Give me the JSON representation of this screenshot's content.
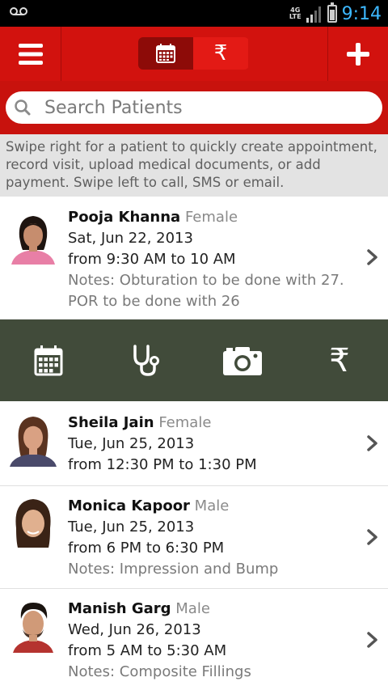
{
  "status_bar": {
    "time": "9:14",
    "network_line1": "4G",
    "network_line2": "LTE",
    "voicemail_icon": "voicemail-icon",
    "accent": "#3db8ff"
  },
  "action_bar": {
    "menu_icon": "menu-icon",
    "calendar_icon": "calendar-icon",
    "rupee_label": "₹",
    "add_icon": "plus-icon",
    "color": "#d2120e"
  },
  "search": {
    "placeholder": "Search Patients"
  },
  "hint": {
    "text": "Swipe right for a patient to quickly create appointment, record visit, upload medical documents, or add payment. Swipe left to call, SMS or email."
  },
  "patients": [
    {
      "name": "Pooja Khanna",
      "gender": "Female",
      "date": "Sat, Jun 22, 2013",
      "time": "from 9:30 AM to 10 AM",
      "notes": "Notes: Obturation to be done with 27. POR to be done with 26"
    },
    {
      "name": "Sheila Jain",
      "gender": "Female",
      "date": "Tue, Jun 25, 2013",
      "time": "from 12:30 PM to 1:30 PM",
      "notes": ""
    },
    {
      "name": "Monica Kapoor",
      "gender": "Male",
      "date": "Tue, Jun 25, 2013",
      "time": "from 6 PM to 6:30 PM",
      "notes": "Notes: Impression and Bump"
    },
    {
      "name": "Manish Garg",
      "gender": "Male",
      "date": "Wed, Jun 26, 2013",
      "time": "from 5 AM to 5:30 AM",
      "notes": "Notes: Composite Fillings"
    }
  ],
  "swipe_actions": {
    "icons": [
      "calendar-icon",
      "stethoscope-icon",
      "camera-icon",
      "rupee-icon"
    ],
    "rupee_label": "₹",
    "background": "#414b3a"
  }
}
